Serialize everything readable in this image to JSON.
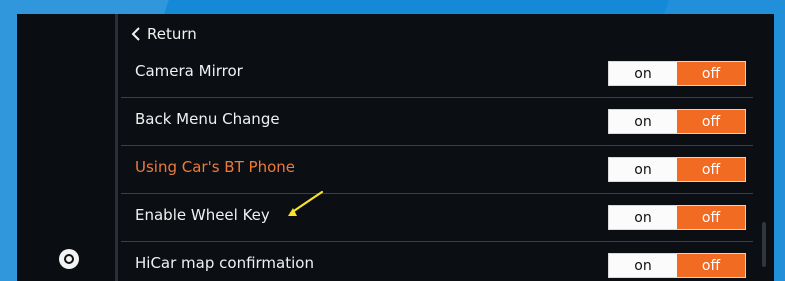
{
  "screen": {
    "nav": {
      "back_label": "Return",
      "back_icon": "chevron-left-icon",
      "home_icon": "home-circle-icon"
    },
    "settings": [
      {
        "label": "Camera Mirror",
        "on_label": "on",
        "off_label": "off",
        "selected": "off"
      },
      {
        "label": "Back Menu Change",
        "on_label": "on",
        "off_label": "off",
        "selected": "off"
      },
      {
        "label": "Using Car's BT Phone",
        "on_label": "on",
        "off_label": "off",
        "selected": "off",
        "highlighted": true
      },
      {
        "label": "Enable Wheel Key",
        "on_label": "on",
        "off_label": "off",
        "selected": "off"
      },
      {
        "label": "HiCar map confirmation",
        "on_label": "on",
        "off_label": "off",
        "selected": "off"
      }
    ],
    "annotation": {
      "arrow_color": "#f6e32d"
    },
    "colors": {
      "frame": "#1489d8",
      "screen": "#0b0e12",
      "toggle_active": "#f26b22",
      "highlight_text": "#f07a38"
    }
  }
}
